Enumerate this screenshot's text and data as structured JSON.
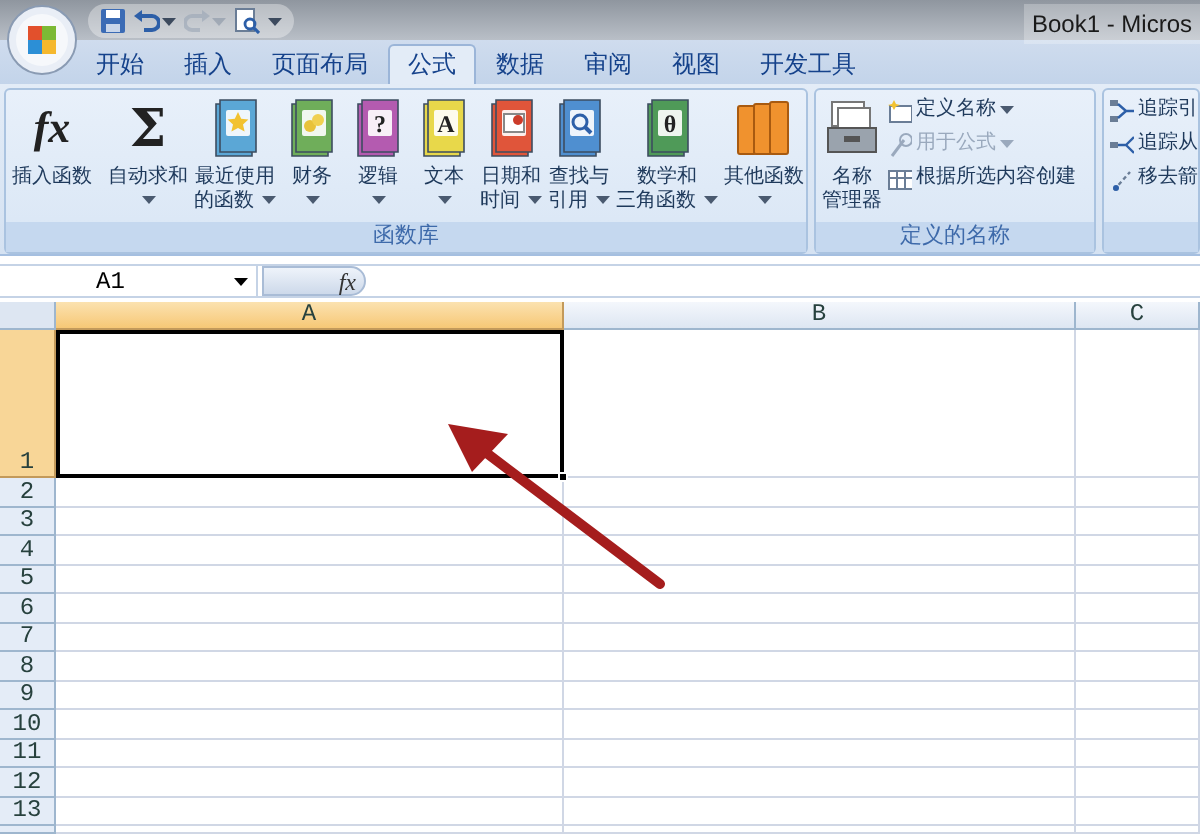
{
  "window": {
    "title": "Book1 - Micros"
  },
  "quick_access": [
    {
      "kind": "save",
      "dropdown": false,
      "disabled": false
    },
    {
      "kind": "undo",
      "dropdown": true,
      "disabled": false
    },
    {
      "kind": "redo",
      "dropdown": true,
      "disabled": true
    },
    {
      "kind": "print_preview",
      "dropdown": false,
      "disabled": false
    },
    {
      "kind": "customize",
      "dropdown": true,
      "disabled": false
    }
  ],
  "tabs": [
    {
      "label": "开始",
      "selected": false
    },
    {
      "label": "插入",
      "selected": false
    },
    {
      "label": "页面布局",
      "selected": false
    },
    {
      "label": "公式",
      "selected": true
    },
    {
      "label": "数据",
      "selected": false
    },
    {
      "label": "审阅",
      "selected": false
    },
    {
      "label": "视图",
      "selected": false
    },
    {
      "label": "开发工具",
      "selected": false
    }
  ],
  "ribbon_groups": [
    {
      "label": "函数库",
      "large_buttons": [
        {
          "lines": [
            "插入函数"
          ],
          "dropdown": false,
          "kind": "fx",
          "icon_text": "fx"
        },
        {
          "lines": [
            "自动求和"
          ],
          "dropdown": true,
          "kind": "sigma",
          "icon_text": "Σ"
        },
        {
          "lines": [
            "最近使用",
            "的函数"
          ],
          "dropdown": true,
          "kind": "starbook",
          "color": "#5ba7d6"
        },
        {
          "lines": [
            "财务"
          ],
          "dropdown": true,
          "kind": "coinbook",
          "color": "#6fae5a"
        },
        {
          "lines": [
            "逻辑"
          ],
          "dropdown": true,
          "kind": "book",
          "color": "#b45bb0",
          "icon_text": "?"
        },
        {
          "lines": [
            "文本"
          ],
          "dropdown": true,
          "kind": "book",
          "color": "#e8d84a",
          "icon_text": "A"
        },
        {
          "lines": [
            "日期和",
            "时间"
          ],
          "dropdown": true,
          "kind": "calendarbook",
          "color": "#e0553a"
        },
        {
          "lines": [
            "查找与",
            "引用"
          ],
          "dropdown": true,
          "kind": "searchbook",
          "color": "#4f8fd0"
        },
        {
          "lines": [
            "数学和",
            "三角函数"
          ],
          "dropdown": true,
          "kind": "book",
          "color": "#4f9a58",
          "icon_text": "θ"
        },
        {
          "lines": [
            "其他函数"
          ],
          "dropdown": true,
          "kind": "books",
          "color": "#f0922e"
        }
      ]
    },
    {
      "label": "定义的名称",
      "large_buttons": [
        {
          "lines": [
            "名称",
            "管理器"
          ],
          "dropdown": false,
          "kind": "name_manager"
        }
      ],
      "small_buttons": [
        {
          "label": "定义名称",
          "kind": "define_name",
          "dropdown": true,
          "disabled": false
        },
        {
          "label": "用于公式",
          "kind": "use_in_formula",
          "dropdown": true,
          "disabled": true
        },
        {
          "label": "根据所选内容创建",
          "kind": "create_from_selection",
          "dropdown": false,
          "disabled": false
        }
      ]
    },
    {
      "small_buttons": [
        {
          "label": "追踪引",
          "kind": "trace_precedents",
          "disabled": false
        },
        {
          "label": "追踪从",
          "kind": "trace_dependents",
          "disabled": false
        },
        {
          "label": "移去箭",
          "kind": "remove_arrows",
          "disabled": false
        }
      ]
    }
  ],
  "formula_bar": {
    "name_box": "A1",
    "function_symbol": "fx"
  },
  "sheet": {
    "columns": [
      {
        "label": "A",
        "selected": true
      },
      {
        "label": "B",
        "selected": false
      },
      {
        "label": "C",
        "selected": false
      }
    ],
    "rows": [
      {
        "label": "1",
        "selected": true
      },
      {
        "label": "2",
        "selected": false
      },
      {
        "label": "3",
        "selected": false
      },
      {
        "label": "4",
        "selected": false
      },
      {
        "label": "5",
        "selected": false
      },
      {
        "label": "6",
        "selected": false
      },
      {
        "label": "7",
        "selected": false
      },
      {
        "label": "8",
        "selected": false
      },
      {
        "label": "9",
        "selected": false
      },
      {
        "label": "10",
        "selected": false
      },
      {
        "label": "11",
        "selected": false
      },
      {
        "label": "12",
        "selected": false
      },
      {
        "label": "13",
        "selected": false
      }
    ]
  },
  "annotations": [
    {
      "kind": "arrow"
    }
  ]
}
